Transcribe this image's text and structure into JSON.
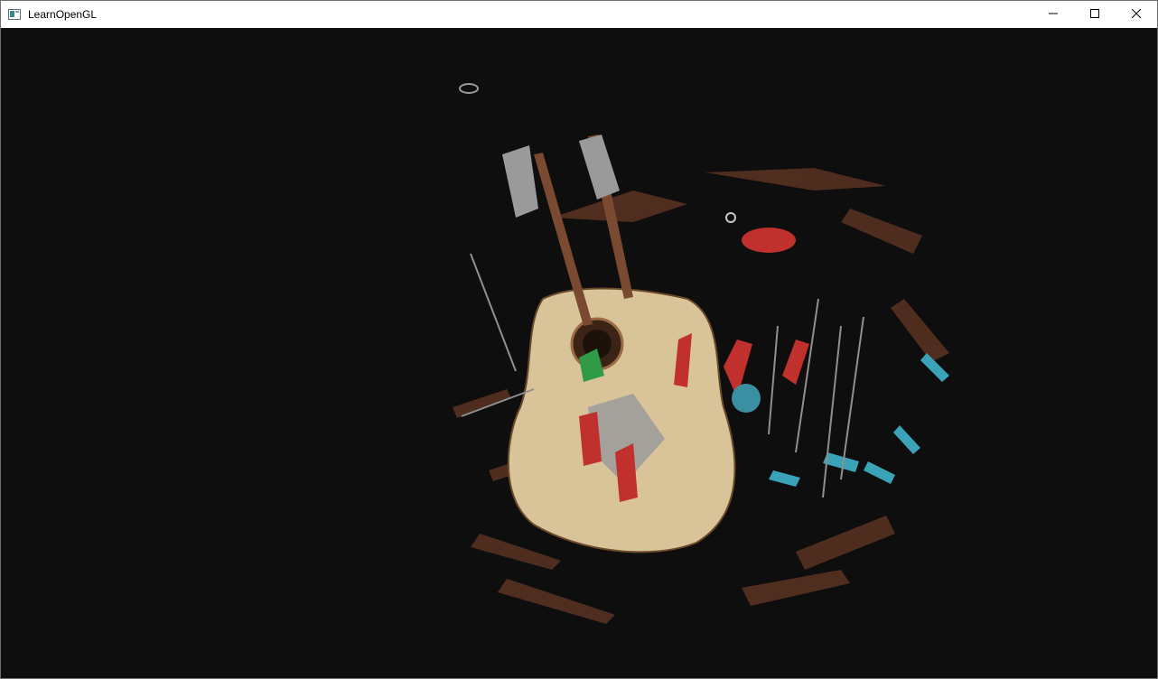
{
  "window": {
    "title": "LearnOpenGL",
    "app_icon": "window-app-icon",
    "controls": {
      "minimize_icon": "minimize-icon",
      "maximize_icon": "maximize-icon",
      "close_icon": "close-icon"
    }
  },
  "viewport": {
    "background": "#0e0e0e",
    "content": "rendered-3d-scene"
  },
  "colors": {
    "wood_light": "#d9c49a",
    "wood_dark": "#5a3322",
    "red": "#c0302c",
    "cyan": "#3aa3b8",
    "green": "#2f9a47",
    "gray": "#9a9a9a"
  }
}
